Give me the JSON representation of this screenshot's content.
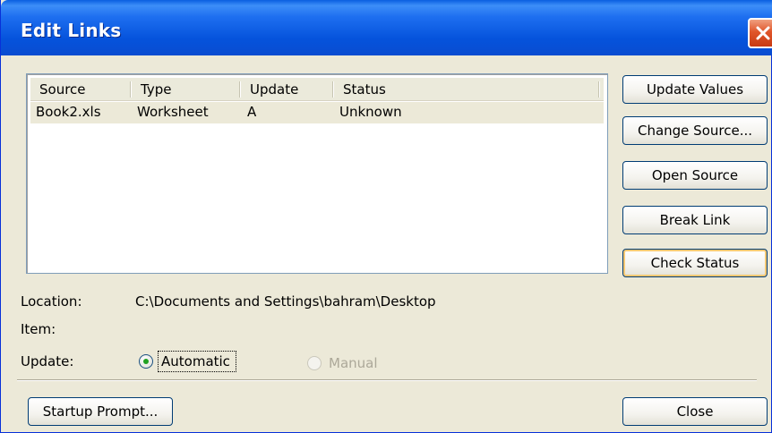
{
  "window": {
    "title": "Edit Links"
  },
  "links_table": {
    "columns": [
      "Source",
      "Type",
      "Update",
      "Status"
    ],
    "rows": [
      {
        "source": "Book2.xls",
        "type": "Worksheet",
        "update": "A",
        "status": "Unknown"
      }
    ]
  },
  "buttons": {
    "update_values": "Update Values",
    "change_source": "Change Source...",
    "open_source": "Open Source",
    "break_link": "Break Link",
    "check_status": "Check Status",
    "startup_prompt": "Startup Prompt...",
    "close": "Close"
  },
  "details": {
    "location_label": "Location:",
    "location_value": "C:\\Documents and Settings\\bahram\\Desktop",
    "item_label": "Item:",
    "update_label": "Update:"
  },
  "update_mode": {
    "automatic_label": "Automatic",
    "manual_label": "Manual",
    "selected": "Automatic"
  },
  "colors": {
    "titlebar": "#0553dc",
    "dialog_bg": "#ece9d8",
    "close_button": "#e0562a",
    "radio_dot": "#21a121"
  }
}
